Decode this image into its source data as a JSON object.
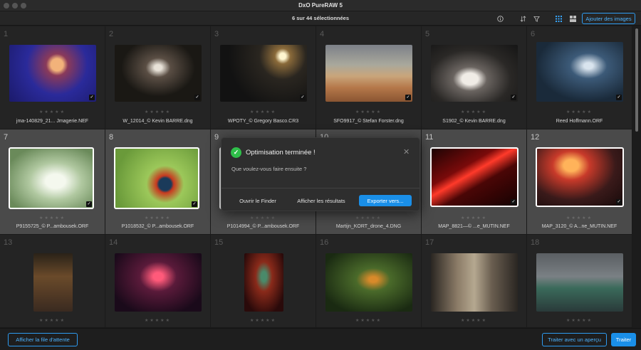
{
  "window": {
    "title": "DxO PureRAW 5"
  },
  "toolbar": {
    "selection_count": "6 sur 44 sélectionnées",
    "add_images_label": "Ajouter des images",
    "icons": [
      "info-icon",
      "sort-icon",
      "filter-icon",
      "grid-view-icon",
      "compare-view-icon"
    ]
  },
  "images": [
    {
      "num": "1",
      "name": "jma-140829_21... Jmagerie.NEF",
      "selected": false
    },
    {
      "num": "2",
      "name": "W_12014_© Kevin BARRE.dng",
      "selected": false
    },
    {
      "num": "3",
      "name": "WPOTY_© Gregory Basco.CR3",
      "selected": false
    },
    {
      "num": "4",
      "name": "SFO9917_© Stefan Forster.dng",
      "selected": false
    },
    {
      "num": "5",
      "name": "S1902_© Kevin BARRE.dng",
      "selected": false
    },
    {
      "num": "6",
      "name": "Reed Hoffmann.ORF",
      "selected": false
    },
    {
      "num": "7",
      "name": "P9155725_© P...ambousek.ORF",
      "selected": true
    },
    {
      "num": "8",
      "name": "P1018532_© P...ambousek.ORF",
      "selected": true
    },
    {
      "num": "9",
      "name": "P1014994_© P...ambousek.ORF",
      "selected": true
    },
    {
      "num": "10",
      "name": "Martijn_KORT_drone_4.DNG",
      "selected": true
    },
    {
      "num": "11",
      "name": "MAP_8821—© ...e_MUTIN.NEF",
      "selected": true
    },
    {
      "num": "12",
      "name": "MAP_3120_© A...ne_MUTIN.NEF",
      "selected": true
    },
    {
      "num": "13",
      "name": "",
      "selected": false
    },
    {
      "num": "14",
      "name": "",
      "selected": false
    },
    {
      "num": "15",
      "name": "",
      "selected": false
    },
    {
      "num": "16",
      "name": "",
      "selected": false
    },
    {
      "num": "17",
      "name": "",
      "selected": false
    },
    {
      "num": "18",
      "name": "",
      "selected": false
    }
  ],
  "stars": "★★★★★",
  "dialog": {
    "title": "Optimisation terminée !",
    "subtitle": "Que voulez-vous faire ensuite ?",
    "close_label": "✕",
    "open_finder": "Ouvrir le Finder",
    "show_results": "Afficher les résultats",
    "export": "Exporter vers..."
  },
  "bottom": {
    "queue_label": "Afficher la file d'attente",
    "preview_process_label": "Traiter avec un aperçu",
    "process_label": "Traiter"
  },
  "colors": {
    "accent": "#1a8fe8",
    "success": "#2fbf4a",
    "selected_cell": "#4a4a4a"
  }
}
